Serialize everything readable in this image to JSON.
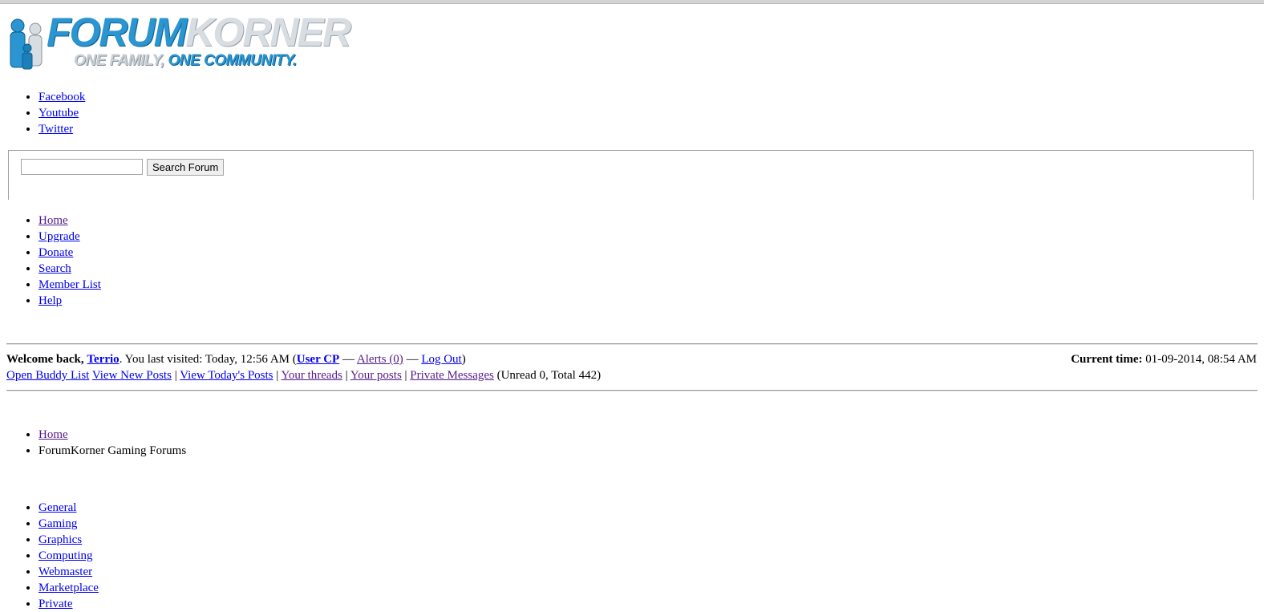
{
  "logo": {
    "title_part1": "FORUM",
    "title_part2": "KORNER",
    "tagline_part1": "ONE FAMILY,",
    "tagline_part2": " ONE COMMUNITY.",
    "brand_blue": "#2a95d1",
    "brand_silver": "#d8dde2"
  },
  "social": [
    "Facebook",
    "Youtube",
    "Twitter"
  ],
  "search": {
    "value": "",
    "button_label": "Search Forum"
  },
  "nav": [
    "Home",
    "Upgrade",
    "Donate",
    "Search",
    "Member List",
    "Help"
  ],
  "welcome": {
    "prefix": "Welcome back,",
    "username": "Terrio",
    "last_visited": ". You last visited: Today, 12:56 AM (",
    "user_cp": "User CP",
    "dash1": " — ",
    "alerts": "Alerts (0)",
    "dash2": " — ",
    "logout": "Log Out",
    "close_paren": ")"
  },
  "current_time": {
    "label": "Current time:",
    "value": " 01-09-2014, 08:54 AM"
  },
  "quick_links": {
    "buddy_list": "Open Buddy List",
    "new_posts": "View New Posts",
    "todays_posts": "View Today's Posts",
    "your_threads": "Your threads",
    "your_posts": "Your posts",
    "private_messages": "Private Messages",
    "pm_counts": "(Unread 0, Total 442)",
    "separator": "|"
  },
  "breadcrumb": {
    "home": "Home",
    "current": "ForumKorner Gaming Forums"
  },
  "categories": [
    "General",
    "Gaming",
    "Graphics",
    "Computing",
    "Webmaster",
    "Marketplace",
    "Private"
  ]
}
